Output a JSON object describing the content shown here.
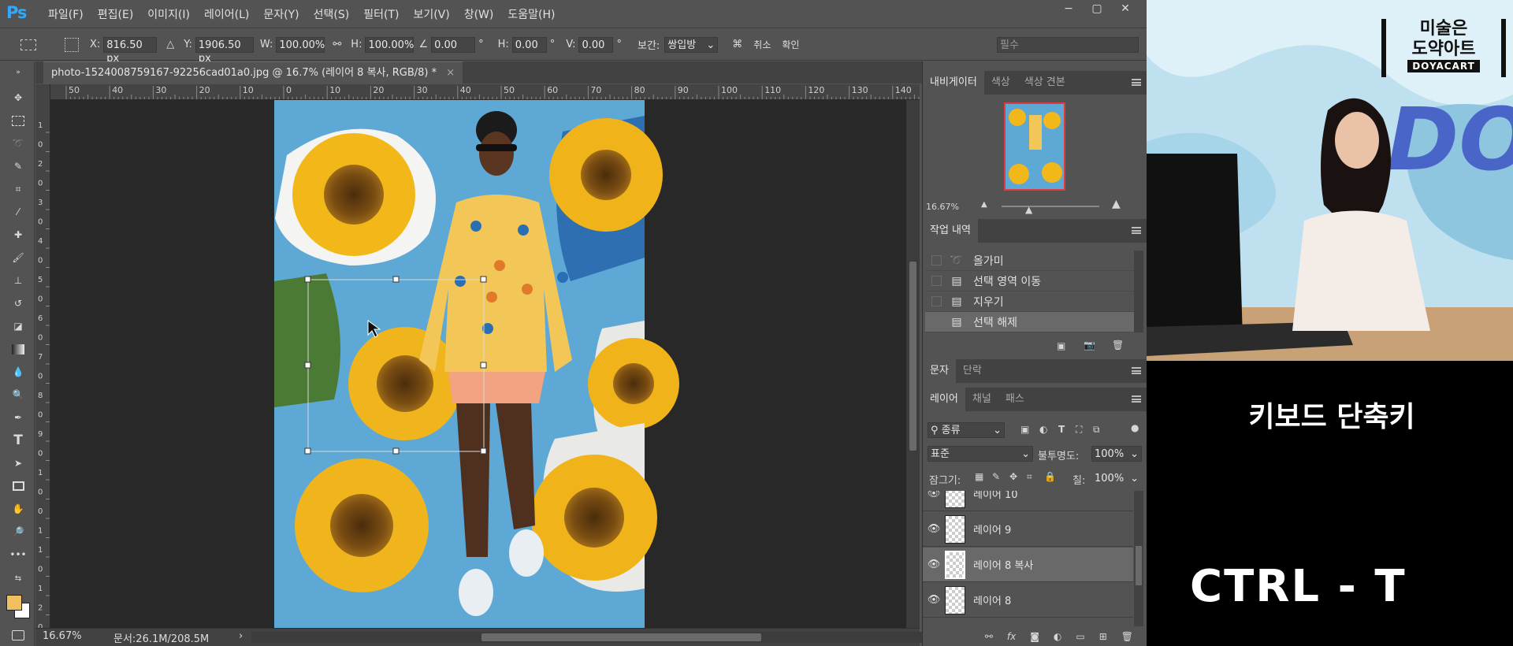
{
  "app": {
    "logo": "Ps"
  },
  "menu": [
    "파일(F)",
    "편집(E)",
    "이미지(I)",
    "레이어(L)",
    "문자(Y)",
    "선택(S)",
    "필터(T)",
    "보기(V)",
    "창(W)",
    "도움말(H)"
  ],
  "window_controls": [
    "−",
    "▢",
    "✕"
  ],
  "options": {
    "x_label": "X:",
    "x_value": "816.50 px",
    "y_label": "Y:",
    "y_value": "1906.50 px",
    "w_label": "W:",
    "w_value": "100.00%",
    "h_label": "H:",
    "h_value": "100.00%",
    "angle_value": "0.00",
    "deg": "°",
    "hskew_label": "H:",
    "hskew_value": "0.00",
    "vskew_label": "V:",
    "vskew_value": "0.00",
    "interp_label": "보간:",
    "interp_value": "쌍입방",
    "cancel": "취소",
    "commit": "확인",
    "workspace": "필수"
  },
  "doc_tab": {
    "title": "photo-1524008759167-92256cad01a0.jpg @ 16.7% (레이어 8 복사, RGB/8) *",
    "close": "×"
  },
  "ruler_h": [
    "50",
    "40",
    "30",
    "20",
    "10",
    "0",
    "10",
    "20",
    "30",
    "40",
    "50",
    "60",
    "70",
    "80",
    "90",
    "100",
    "110",
    "120",
    "130",
    "140"
  ],
  "ruler_v": [
    "1",
    "0",
    "2",
    "0",
    "3",
    "0",
    "4",
    "0",
    "5",
    "0",
    "6",
    "0",
    "7",
    "0",
    "8",
    "0",
    "9",
    "0",
    "1",
    "0",
    "0",
    "1",
    "1",
    "0",
    "1",
    "2",
    "0"
  ],
  "status": {
    "zoom": "16.67%",
    "doc": "문서:26.1M/208.5M"
  },
  "navigator": {
    "tabs": [
      "내비게이터",
      "색상",
      "색상 견본"
    ],
    "zoom": "16.67%"
  },
  "history": {
    "tab": "작업 내역",
    "items": [
      {
        "label": "올가미",
        "icon": "lasso-icon"
      },
      {
        "label": "선택 영역 이동",
        "icon": "history-step-icon"
      },
      {
        "label": "지우기",
        "icon": "history-step-icon"
      },
      {
        "label": "선택 해제",
        "icon": "history-step-icon",
        "selected": true
      }
    ]
  },
  "char_panel": {
    "tabs": [
      "문자",
      "단락"
    ]
  },
  "layers": {
    "tabs": [
      "레이어",
      "채널",
      "패스"
    ],
    "filter_label": "종류",
    "blend": "표준",
    "opacity_label": "불투명도:",
    "opacity_value": "100%",
    "lock_label": "잠그기:",
    "fill_label": "칠:",
    "fill_value": "100%",
    "items": [
      {
        "name": "레이어 10"
      },
      {
        "name": "레이어 9"
      },
      {
        "name": "레이어 8 복사",
        "selected": true
      },
      {
        "name": "레이어 8"
      }
    ],
    "footer_fx": "fx"
  },
  "video": {
    "brand_line1": "미술은",
    "brand_line2": "도약아트",
    "brand_en": "DOYACART",
    "caption": "키보드 단축키",
    "shortcut": "CTRL - T"
  }
}
